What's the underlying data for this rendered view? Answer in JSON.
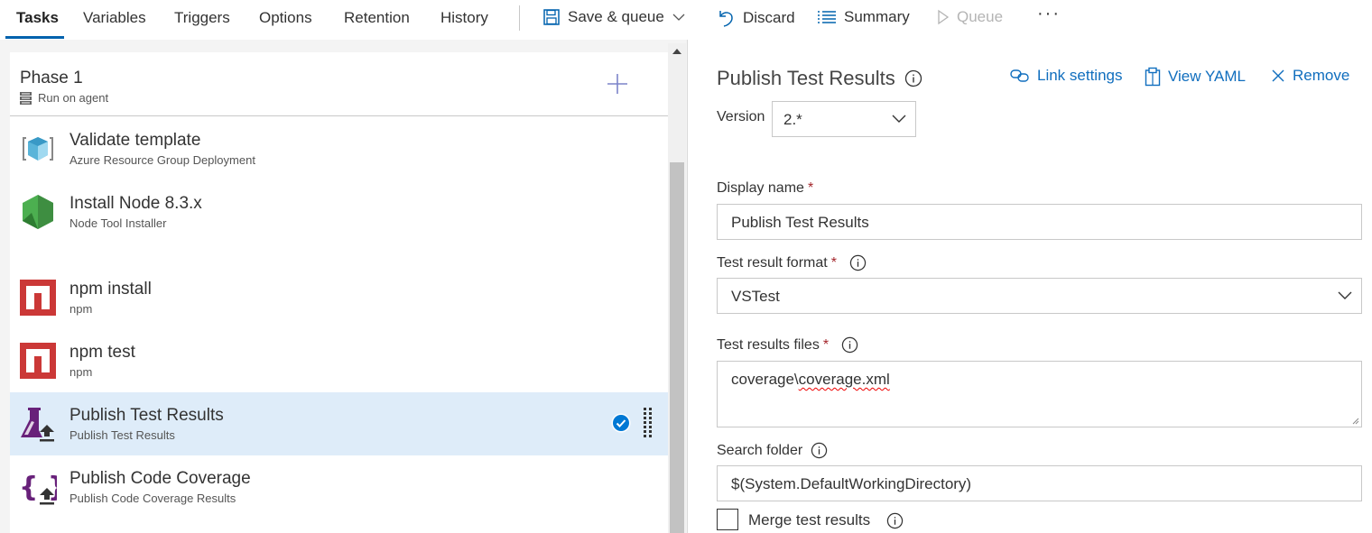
{
  "tabs": [
    {
      "label": "Tasks",
      "active": true
    },
    {
      "label": "Variables"
    },
    {
      "label": "Triggers"
    },
    {
      "label": "Options"
    },
    {
      "label": "Retention"
    },
    {
      "label": "History"
    }
  ],
  "toolbar": {
    "save_queue": "Save & queue",
    "discard": "Discard",
    "summary": "Summary",
    "queue": "Queue",
    "more": "···"
  },
  "phase": {
    "title": "Phase 1",
    "subtitle": "Run on agent"
  },
  "tasks": [
    {
      "name": "Validate template",
      "sub": "Azure Resource Group Deployment",
      "icon": "azure-resource-group-icon"
    },
    {
      "name": "Install Node 8.3.x",
      "sub": "Node Tool Installer",
      "icon": "nodejs-icon"
    },
    {
      "name": "npm install",
      "sub": "npm",
      "icon": "npm-icon"
    },
    {
      "name": "npm test",
      "sub": "npm",
      "icon": "npm-icon"
    },
    {
      "name": "Publish Test Results",
      "sub": "Publish Test Results",
      "icon": "publish-test-results-icon",
      "selected": true
    },
    {
      "name": "Publish Code Coverage",
      "sub": "Publish Code Coverage Results",
      "icon": "publish-code-coverage-icon"
    }
  ],
  "details": {
    "title": "Publish Test Results",
    "link_settings": "Link settings",
    "view_yaml": "View YAML",
    "remove": "Remove",
    "version_label": "Version",
    "version_value": "2.*",
    "display_name_label": "Display name",
    "display_name_value": "Publish Test Results",
    "format_label": "Test result format",
    "format_value": "VSTest",
    "files_label": "Test results files",
    "files_value_prefix": "coverage\\",
    "files_value_misspelled": "coverage.xml",
    "search_folder_label": "Search folder",
    "search_folder_value": "$(System.DefaultWorkingDirectory)",
    "merge_label": "Merge test results",
    "merge_checked": false,
    "required_marker": "*"
  },
  "colors": {
    "accent": "#0062ad",
    "link": "#106ebe",
    "selected_row": "#deecf9",
    "required": "#a4262c",
    "npm_red": "#cb3837",
    "purple": "#68217a"
  }
}
